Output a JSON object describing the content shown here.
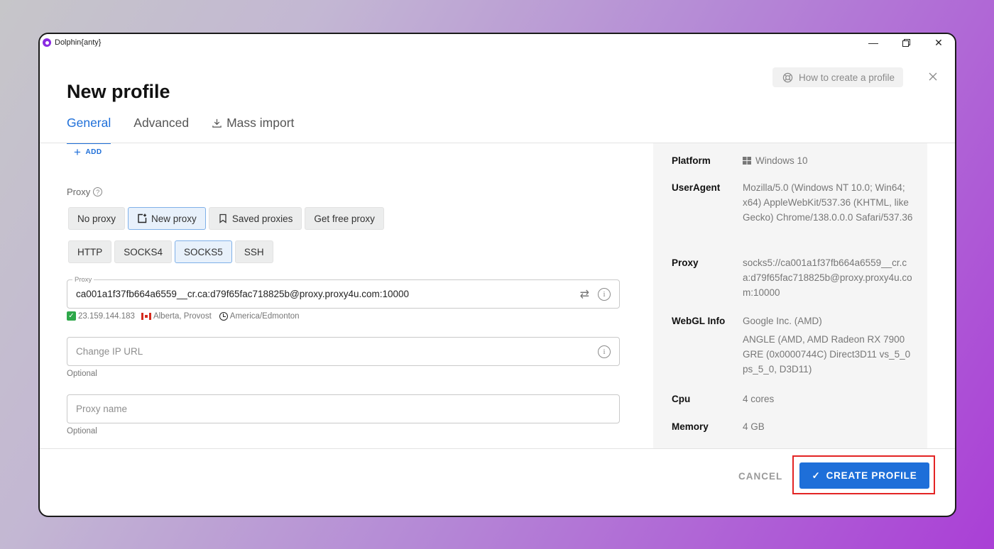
{
  "window": {
    "title": "Dolphin{anty}",
    "controls": {
      "minimize": "—",
      "restore": "restore-icon",
      "close": "✕"
    }
  },
  "help": {
    "label": "How to create a profile",
    "icon": "lifebuoy-icon"
  },
  "page": {
    "title": "New profile"
  },
  "tabs": [
    {
      "label": "General",
      "active": true
    },
    {
      "label": "Advanced",
      "active": false
    },
    {
      "label": "Mass import",
      "active": false,
      "icon": "download-icon"
    }
  ],
  "add_label": "ADD",
  "proxy": {
    "label": "Proxy",
    "modes": [
      {
        "label": "No proxy",
        "selected": false
      },
      {
        "label": "New proxy",
        "selected": true,
        "icon": "add-box-icon"
      },
      {
        "label": "Saved proxies",
        "selected": false,
        "icon": "bookmark-icon"
      },
      {
        "label": "Get free proxy",
        "selected": false
      }
    ],
    "types": [
      {
        "label": "HTTP",
        "selected": false
      },
      {
        "label": "SOCKS4",
        "selected": false
      },
      {
        "label": "SOCKS5",
        "selected": true
      },
      {
        "label": "SSH",
        "selected": false
      }
    ],
    "field_legend": "Proxy",
    "value": "ca001a1f37fb664a6559__cr.ca:d79f65fac718825b@proxy.proxy4u.com:10000",
    "check": {
      "ip": "23.159.144.183",
      "location": "Alberta, Provost",
      "timezone": "America/Edmonton"
    },
    "change_ip_placeholder": "Change IP URL",
    "change_ip_hint": "Optional",
    "name_placeholder": "Proxy name",
    "name_hint": "Optional"
  },
  "summary": {
    "platform_label": "Platform",
    "platform_value": "Windows 10",
    "useragent_label": "UserAgent",
    "useragent_value": "Mozilla/5.0 (Windows NT 10.0; Win64; x64) AppleWebKit/537.36 (KHTML, like Gecko) Chrome/138.0.0.0 Safari/537.36",
    "proxy_label": "Proxy",
    "proxy_value": "socks5://ca001a1f37fb664a6559__cr.ca:d79f65fac718825b@proxy.proxy4u.com:10000",
    "webgl_label": "WebGL Info",
    "webgl_vendor": "Google Inc. (AMD)",
    "webgl_renderer": "ANGLE (AMD, AMD Radeon RX 7900 GRE (0x0000744C) Direct3D11 vs_5_0 ps_5_0, D3D11)",
    "cpu_label": "Cpu",
    "cpu_value": "4 cores",
    "memory_label": "Memory",
    "memory_value": "4 GB"
  },
  "footer": {
    "cancel_label": "CANCEL",
    "create_label": "CREATE PROFILE"
  },
  "colors": {
    "accent": "#1e6fd9",
    "highlight": "#e32424",
    "check": "#2ea84a"
  }
}
